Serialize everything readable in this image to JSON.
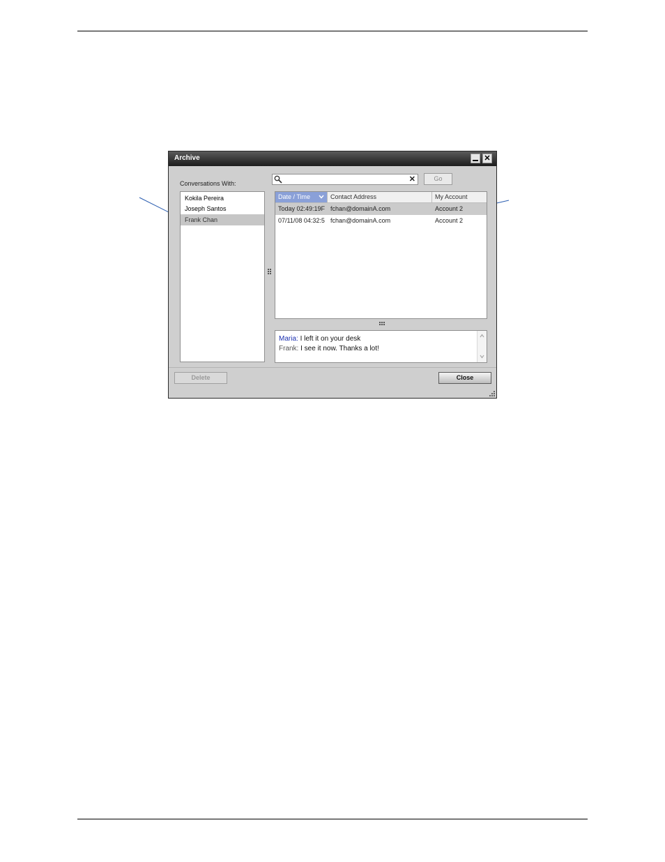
{
  "window": {
    "title": "Archive",
    "minimize_icon": "minimize-icon",
    "close_icon": "close-icon",
    "close_glyph": "✕"
  },
  "conversations": {
    "label": "Conversations With:",
    "items": [
      {
        "label": "Kokila Pereira"
      },
      {
        "label": "Joseph Santos"
      },
      {
        "label": "Frank Chan",
        "selected": true
      }
    ]
  },
  "search": {
    "value": "",
    "placeholder": "",
    "clear_glyph": "✕",
    "go_label": "Go"
  },
  "table": {
    "columns": [
      "Date / Time",
      "Contact Address",
      "My Account"
    ],
    "sorted_column": "Date / Time",
    "rows": [
      {
        "datetime": "Today 02:49:19F",
        "address": "fchan@domainA.com",
        "account": "Account 2",
        "selected": true
      },
      {
        "datetime": "07/11/08 04:32:5",
        "address": "fchan@domainA.com",
        "account": "Account 2"
      }
    ]
  },
  "preview": {
    "messages": [
      {
        "sender": "Maria:",
        "text": " I left it on your desk"
      },
      {
        "sender": "Frank:",
        "text": " I see it now. Thanks a lot!"
      }
    ]
  },
  "buttons": {
    "delete_label": "Delete",
    "close_label": "Close"
  },
  "colors": {
    "titlebar": "#1c1c1c",
    "window_bg": "#cfcfcf",
    "sorted_header": "#8aa0d8",
    "selection": "#c6c6c6",
    "maria_sender": "#1a2fb0"
  }
}
